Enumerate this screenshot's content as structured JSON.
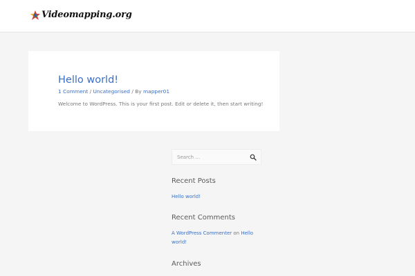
{
  "header": {
    "logo_text": "Videomapping.org",
    "logo_icon": "colorful-star-logo"
  },
  "post": {
    "title": "Hello world!",
    "meta": {
      "comments": "1 Comment",
      "sep1": " / ",
      "category": "Uncategorised",
      "sep2": " / By ",
      "author": "mapper01"
    },
    "excerpt": "Welcome to WordPress. This is your first post. Edit or delete it, then start writing!"
  },
  "sidebar": {
    "search": {
      "placeholder": "Search …",
      "icon": "search-icon"
    },
    "recent_posts": {
      "title": "Recent Posts",
      "items": [
        "Hello world!"
      ]
    },
    "recent_comments": {
      "title": "Recent Comments",
      "items": [
        {
          "author": "A WordPress Commenter",
          "on": " on ",
          "post": "Hello world!"
        }
      ]
    },
    "archives": {
      "title": "Archives"
    }
  },
  "colors": {
    "link": "#3a6fc4",
    "background": "#f5f5f5",
    "card": "#ffffff"
  }
}
